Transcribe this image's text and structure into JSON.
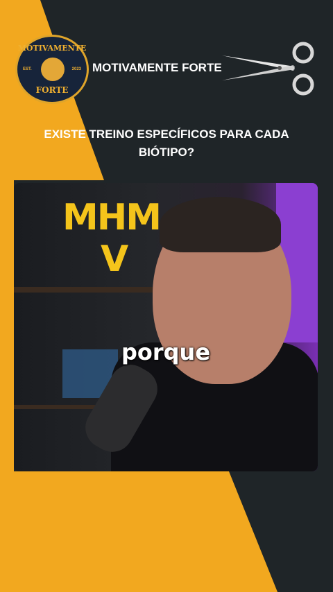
{
  "logo": {
    "top_text": "MOTIVAMENTE",
    "bottom_text": "FORTE",
    "est_label": "EST.",
    "year_label": "2023"
  },
  "brand_title": "MOTIVAMENTE FORTE",
  "question_line1": "EXISTE TREINO ESPECÍFICOS PARA CADA",
  "question_line2": "BIÓTIPO?",
  "video": {
    "studio_logo": "MHM",
    "studio_logo_v": "V",
    "caption": "porque"
  },
  "icons": {
    "scissors": "scissors-icon",
    "logo_emblem": "eagle-icon"
  },
  "colors": {
    "yellow": "#f2a81f",
    "dark": "#1f2528",
    "navy": "#17243a",
    "purple": "#8b3fd1"
  }
}
